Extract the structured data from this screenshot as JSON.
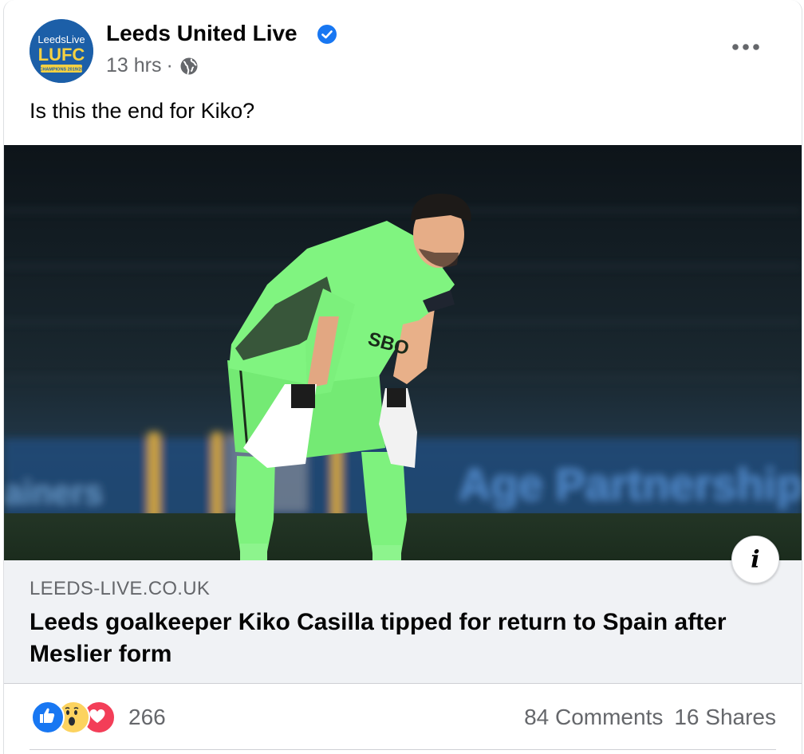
{
  "post": {
    "page_name": "Leeds United Live",
    "timestamp": "13 hrs",
    "separator": "·",
    "message": "Is this the end for Kiko?",
    "avatar": {
      "line1": "LeedsLive",
      "line2": "LUFC",
      "line3": "CHAMPIONS 2019/20"
    },
    "photo_text": {
      "shirt_sponsor": "SBO",
      "board_left": "ainers",
      "board_right": "Age Partnership"
    }
  },
  "link_preview": {
    "domain": "LEEDS-LIVE.CO.UK",
    "title": "Leeds goalkeeper Kiko Casilla tipped for return to Spain after Meslier form",
    "info_label": "i"
  },
  "engagement": {
    "reaction_count": "266",
    "comments": "84 Comments",
    "shares": "16 Shares",
    "reaction_icons": [
      "like-icon",
      "wow-icon",
      "love-icon"
    ]
  },
  "colors": {
    "verified_blue": "#1877f2",
    "like_blue": "#1877f2",
    "love_red": "#f33e58",
    "wow_yellow": "#fcd35f",
    "kit_green": "#7ef27e",
    "secondary_text": "#65676b"
  }
}
